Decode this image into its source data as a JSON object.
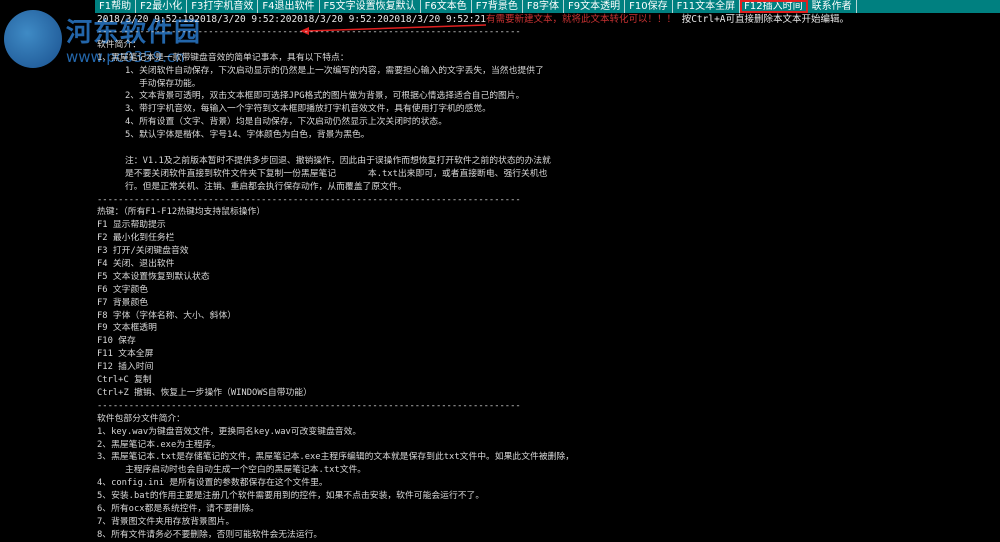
{
  "toolbar": {
    "buttons": [
      {
        "label": "F1帮助"
      },
      {
        "label": "F2最小化"
      },
      {
        "label": "F3打字机音效"
      },
      {
        "label": "F4退出软件"
      },
      {
        "label": "F5文字设置恢复默认"
      },
      {
        "label": "F6文本色"
      },
      {
        "label": "F7背景色"
      },
      {
        "label": "F8字体"
      },
      {
        "label": "F9文本透明"
      },
      {
        "label": "F10保存"
      },
      {
        "label": "F11文本全屏"
      },
      {
        "label": "F12插入时间"
      },
      {
        "label": "联系作者"
      }
    ]
  },
  "watermark": {
    "site_name": "河东软件园",
    "url": "www.pc0359.cn"
  },
  "timeline": {
    "timestamps": "2018/3/20 9:52:192018/3/20 9:52:202018/3/20 9:52:202018/3/20 9:52:21",
    "overlay": "有需要新建文本，就将此文本转化可以！！！",
    "tip": "按Ctrl+A可直接删除本文本开始编辑。"
  },
  "editor": {
    "separator": "--------------------------------------------------------------------------------",
    "intro_title": "软件简介：",
    "intro": [
      "1、黑屋笔记本是一款带键盘音效的简单记事本，具有以下特点：",
      "1、关闭软件自动保存，下次启动显示的仍然是上一次编写的内容，需要担心输入的文字丢失，当然也提供了",
      "手动保存功能。",
      "2、文本背景可透明，双击文本框即可选择JPG格式的图片做为背景，可根据心情选择适合自己的图片。",
      "3、带打字机音效，每输入一个字符到文本框即播放打字机音效文件，具有使用打字机的感觉。",
      "4、所有设置（文字、背景）均是自动保存，下次启动仍然显示上次关闭时的状态。",
      "5、默认字体是楷体、字号14、字体颜色为白色，背景为黑色。"
    ],
    "notes": [
      "注：V1.1及之前版本暂时不提供多步回退、撤销操作，因此由于误操作而想恢复打开软件之前的状态的办法就",
      "是不要关闭软件直接到软件文件夹下复制一份黑屋笔记      本.txt出来即可，或者直接断电、强行关机也",
      "行。但是正常关机、注销、重启都会执行保存动作，从而覆盖了原文件。"
    ],
    "hotkeys_title": "热键：（所有F1-F12热键均支持鼠标操作）",
    "hotkeys": [
      "F1 显示帮助提示",
      "F2 最小化到任务栏",
      "F3 打开/关闭键盘音效",
      "F4 关闭、退出软件",
      "F5 文本设置恢复到默认状态",
      "F6 文字颜色",
      "F7 背景颜色",
      "F8 字体（字体名称、大小、斜体）",
      "F9 文本框透明",
      "F10 保存",
      "F11 文本全屏",
      "F12 插入时间",
      "Ctrl+C 复制",
      "Ctrl+Z 撤销、恢复上一步操作（WINDOWS自带功能）"
    ],
    "files_title": "软件包部分文件简介：",
    "files": [
      "1、key.wav为键盘音效文件，更换同名key.wav可改变键盘音效。",
      "2、黑屋笔记本.exe为主程序。",
      "3、黑屋笔记本.txt是存储笔记的文件，黑屋笔记本.exe主程序编辑的文本就是保存到此txt文件中。如果此文件被删除，",
      "主程序启动时也会自动生成一个空白的黑屋笔记本.txt文件。",
      "4、config.ini 是所有设置的参数都保存在这个文件里。",
      "5、安装.bat的作用主要是注册几个软件需要用到的控件，如果不点击安装，软件可能会运行不了。",
      "6、所有ocx都是系统控件，请不要删除。",
      "7、背景图文件夹用存放背景图片。",
      "8、所有文件请务必不要删除，否则可能软件会无法运行。"
    ]
  },
  "colors": {
    "toolbar_bg": "#008080",
    "background": "#000000",
    "text": "#d8d8d8",
    "highlight": "#e02020"
  }
}
